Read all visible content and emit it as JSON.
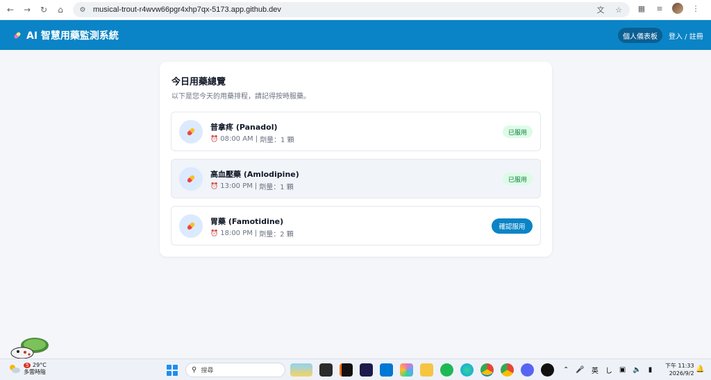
{
  "browser": {
    "url": "musical-trout-r4wvw66pgr4xhp7qx-5173.app.github.dev"
  },
  "app": {
    "title": "AI 智慧用藥監測系統",
    "dashboard_label": "個人儀表板",
    "login_label": "登入 / 註冊"
  },
  "overview": {
    "title": "今日用藥總覽",
    "subtitle": "以下是您今天的用藥排程，請記得按時服藥。",
    "medications": [
      {
        "name": "普拿疼 (Panadol)",
        "time": "08:00 AM",
        "dose": "劑量：1 顆",
        "status": "已服用"
      },
      {
        "name": "高血壓藥 (Amlodipine)",
        "time": "13:00 PM",
        "dose": "劑量：1 顆",
        "status": "已服用"
      },
      {
        "name": "胃藥 (Famotidine)",
        "time": "18:00 PM",
        "dose": "劑量：2 顆",
        "action": "確認服用"
      }
    ]
  },
  "taskbar": {
    "weather_temp": "29°C",
    "weather_desc": "多雲時陰",
    "weather_badge": "5",
    "search_placeholder": "搜尋",
    "ime_label": "英",
    "time": "下午 11:33",
    "date": "2026/9/2"
  },
  "colors": {
    "header": "#0a84c6",
    "taken_badge": "#dcfce7",
    "taken_text": "#15803d",
    "primary_button": "#0a84c6"
  }
}
